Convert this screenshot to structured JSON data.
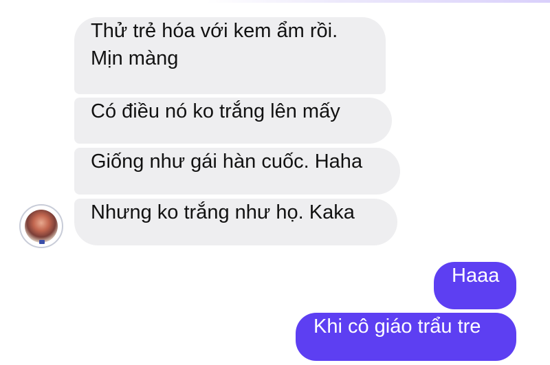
{
  "conversation": {
    "incoming": [
      {
        "lines": [
          "Thử trẻ hóa với kem ẩm rồi.",
          "Mịn màng"
        ]
      },
      {
        "lines": [
          "Có điều nó ko trắng lên mấy"
        ]
      },
      {
        "lines": [
          "Giống như gái hàn cuốc. Haha"
        ]
      },
      {
        "lines": [
          "Nhưng ko trắng như họ. Kaka"
        ]
      }
    ],
    "outgoing": [
      {
        "text": "Haaa"
      },
      {
        "text": "Khi cô giáo trẩu tre"
      }
    ]
  },
  "colors": {
    "incoming_bubble": "#eeeef0",
    "outgoing_bubble": "#5d3ff2",
    "outgoing_text": "#ffffff",
    "incoming_text": "#111111"
  },
  "icons": {
    "avatar": "sender-avatar"
  }
}
